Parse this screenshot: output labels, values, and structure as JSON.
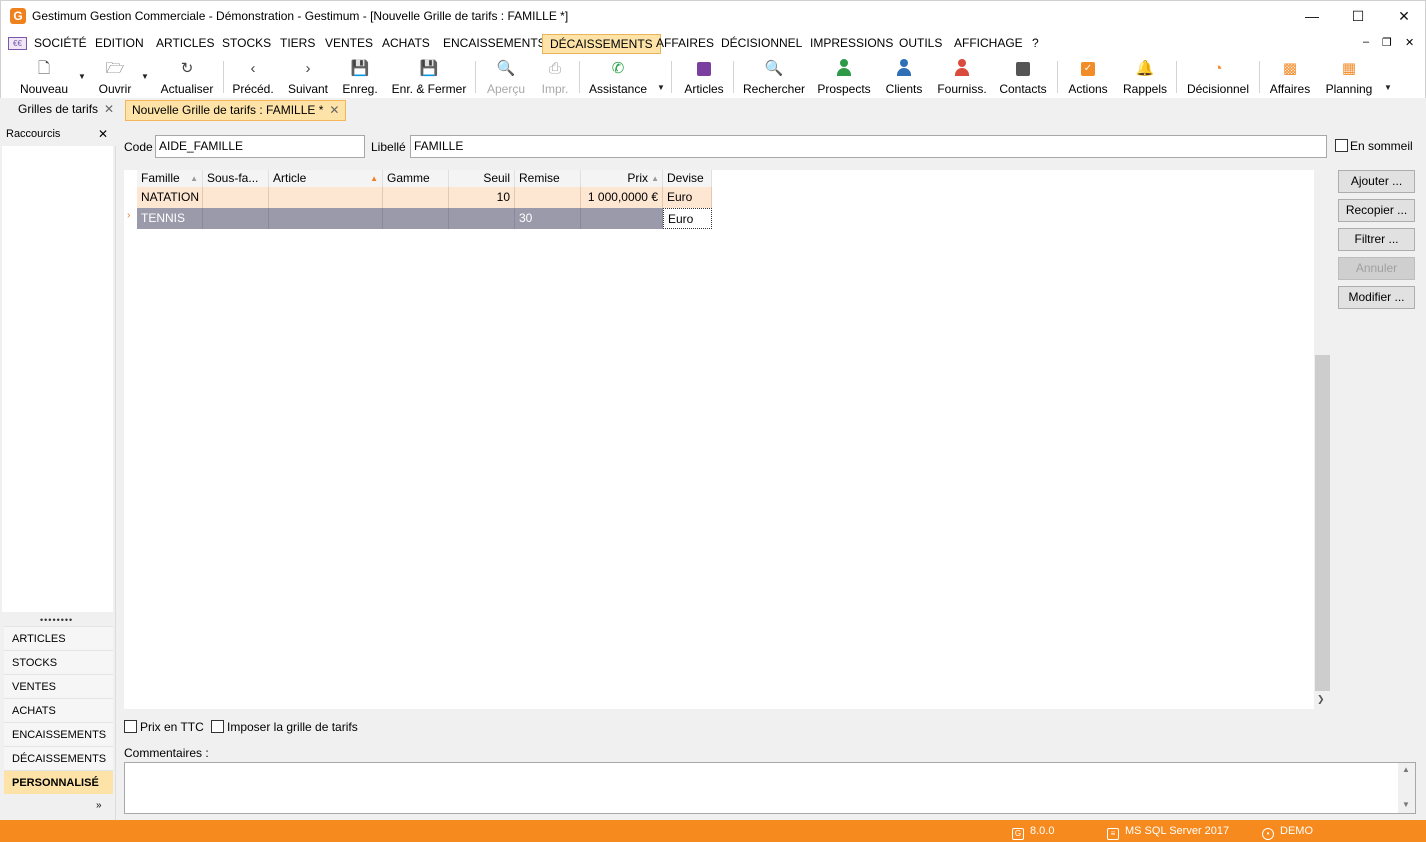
{
  "window": {
    "title": "Gestimum Gestion Commerciale - Démonstration - Gestimum - [Nouvelle Grille de tarifs : FAMILLE *]",
    "logo_letter": "G"
  },
  "menu": {
    "items": [
      {
        "label": "SOCIÉTÉ"
      },
      {
        "label": "EDITION"
      },
      {
        "label": "ARTICLES"
      },
      {
        "label": "STOCKS"
      },
      {
        "label": "TIERS"
      },
      {
        "label": "VENTES"
      },
      {
        "label": "ACHATS"
      },
      {
        "label": "ENCAISSEMENTS"
      },
      {
        "label": "DÉCAISSEMENTS"
      },
      {
        "label": "AFFAIRES"
      },
      {
        "label": "DÉCISIONNEL"
      },
      {
        "label": "IMPRESSIONS"
      },
      {
        "label": "OUTILS"
      },
      {
        "label": "AFFICHAGE"
      },
      {
        "label": "?"
      }
    ],
    "active": "DÉCAISSEMENTS"
  },
  "toolbar": {
    "nouveau": "Nouveau",
    "ouvrir": "Ouvrir",
    "actualiser": "Actualiser",
    "preced": "Précéd.",
    "suivant": "Suivant",
    "enreg": "Enreg.",
    "enr_fermer": "Enr. & Fermer",
    "apercu": "Aperçu",
    "impr": "Impr.",
    "assistance": "Assistance",
    "articles": "Articles",
    "rechercher": "Rechercher",
    "prospects": "Prospects",
    "clients": "Clients",
    "fourniss": "Fourniss.",
    "contacts": "Contacts",
    "actions": "Actions",
    "rappels": "Rappels",
    "decisionnel": "Décisionnel",
    "affaires": "Affaires",
    "planning": "Planning"
  },
  "tabs": {
    "list_tab": "Grilles de tarifs",
    "active_tab": "Nouvelle Grille de tarifs : FAMILLE *"
  },
  "sidebar": {
    "title": "Raccourcis",
    "items": [
      {
        "label": "ARTICLES"
      },
      {
        "label": "STOCKS"
      },
      {
        "label": "VENTES"
      },
      {
        "label": "ACHATS"
      },
      {
        "label": "ENCAISSEMENTS"
      },
      {
        "label": "DÉCAISSEMENTS"
      },
      {
        "label": "PERSONNALISÉ"
      }
    ],
    "active": "PERSONNALISÉ"
  },
  "form": {
    "code_label": "Code",
    "code_value": "AIDE_FAMILLE",
    "libelle_label": "Libellé",
    "libelle_value": "FAMILLE",
    "en_sommeil_label": "En sommeil",
    "prix_ttc_label": "Prix en TTC",
    "imposer_label": "Imposer la grille de tarifs",
    "commentaires_label": "Commentaires :"
  },
  "grid": {
    "columns": [
      "Famille",
      "Sous-fa...",
      "Article",
      "Gamme",
      "Seuil",
      "Remise",
      "Prix",
      "Devise"
    ],
    "rows": [
      {
        "famille": "NATATION",
        "sous_famille": "",
        "article": "",
        "gamme": "",
        "seuil": "10",
        "remise": "",
        "prix": "1 000,0000 €",
        "devise": "Euro"
      },
      {
        "famille": "TENNIS",
        "sous_famille": "",
        "article": "",
        "gamme": "",
        "seuil": "",
        "remise": "30",
        "prix": "",
        "devise": "Euro"
      }
    ]
  },
  "actions": {
    "ajouter": "Ajouter ...",
    "recopier": "Recopier ...",
    "filtrer": "Filtrer ...",
    "annuler": "Annuler",
    "modifier": "Modifier ..."
  },
  "status": {
    "version": "8.0.0",
    "server": "MS SQL Server 2017",
    "user": "DEMO"
  },
  "colors": {
    "accent_orange": "#f68a1e",
    "active_tab": "#fde3a7",
    "selected_row": "#9b9aaa",
    "highlight_row": "#fde6d2"
  }
}
